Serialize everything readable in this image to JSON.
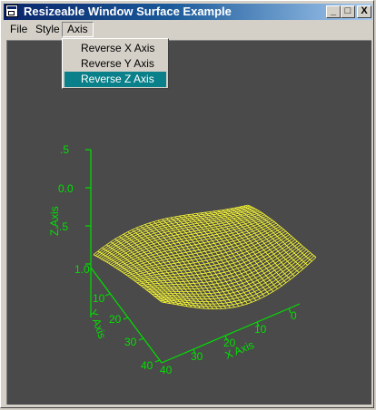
{
  "window": {
    "title": "Resizeable Window Surface Example",
    "buttons": {
      "minimize": "_",
      "maximize": "□",
      "close": "X"
    }
  },
  "menubar": {
    "items": [
      {
        "label": "File"
      },
      {
        "label": "Style"
      },
      {
        "label": "Axis"
      }
    ]
  },
  "dropdown": {
    "items": [
      {
        "label": "Reverse X Axis"
      },
      {
        "label": "Reverse Y Axis"
      },
      {
        "label": "Reverse Z Axis"
      }
    ],
    "highlighted": "Reverse Z Axis"
  },
  "plot": {
    "axis_color": "#00e000",
    "surface_color": "#ffff33",
    "background": "#4a4a4a",
    "z_axis": {
      "label": "Z Axis",
      "ticks": [
        ".5",
        "0.0",
        "-.5",
        "1.0"
      ]
    },
    "y_axis": {
      "label": "Y Axis",
      "ticks": [
        "10",
        "20",
        "30",
        "40"
      ]
    },
    "x_axis": {
      "label": "X Axis",
      "ticks": [
        "40",
        "30",
        "20",
        "10",
        "0"
      ]
    }
  }
}
